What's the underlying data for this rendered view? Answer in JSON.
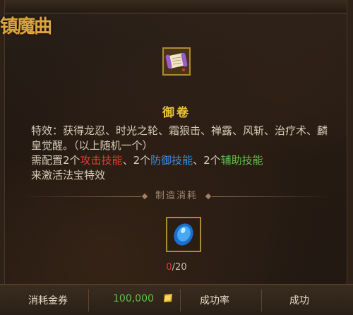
{
  "logo": {
    "text": "镇魔曲"
  },
  "item": {
    "icon": "scroll-icon",
    "name": "御卷",
    "effect_text": "特效：获得龙忍、时光之轮、霜狼击、禅露、风斩、治疗术、麟皇觉醒。（以上随机一个）",
    "requirement": {
      "prefix": "需配置2个",
      "attack_skill": "攻击技能",
      "sep1": "、2个",
      "defense_skill": "防御技能",
      "sep2": "、2个",
      "support_skill": "辅助技能",
      "suffix": "来激活法宝特效"
    }
  },
  "crafting": {
    "section_label": "制造消耗",
    "material_icon": "blue-gem-icon",
    "owned": "0",
    "required": "/20"
  },
  "footer": {
    "cost_label": "消耗金券",
    "cost_value": "100,000",
    "cost_icon": "gold-ticket-icon",
    "success_rate_label": "成功率",
    "success_value": "成功"
  },
  "colors": {
    "attack": "#e33b2e",
    "defense": "#3c8fe6",
    "support": "#5ec34a",
    "item_name": "#e8c33a"
  }
}
